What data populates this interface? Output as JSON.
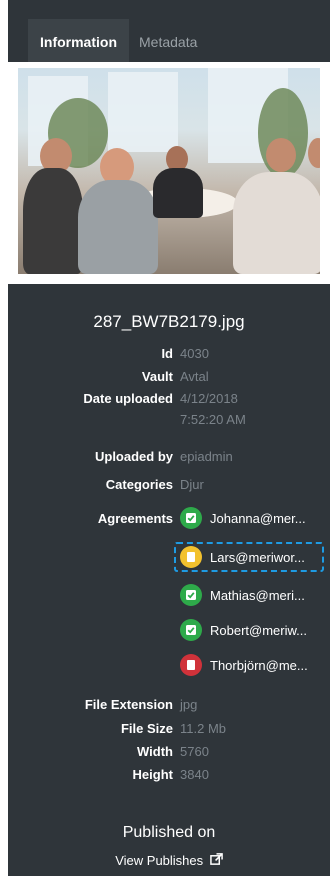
{
  "tabs": [
    {
      "label": "Information",
      "active": true
    },
    {
      "label": "Metadata",
      "active": false
    }
  ],
  "file": {
    "name": "287_BW7B2179.jpg",
    "fields": {
      "id": {
        "label": "Id",
        "value": "4030"
      },
      "vault": {
        "label": "Vault",
        "value": "Avtal"
      },
      "date_uploaded": {
        "label": "Date uploaded",
        "value": "4/12/2018 7:52:20 AM"
      },
      "uploaded_by": {
        "label": "Uploaded by",
        "value": "epiadmin"
      },
      "categories": {
        "label": "Categories",
        "value": "Djur"
      },
      "agreements_label": "Agreements",
      "file_extension": {
        "label": "File Extension",
        "value": "jpg"
      },
      "file_size": {
        "label": "File Size",
        "value": "11.2 Mb"
      },
      "width": {
        "label": "Width",
        "value": "5760"
      },
      "height": {
        "label": "Height",
        "value": "3840"
      }
    }
  },
  "agreements": [
    {
      "name": "Johanna@mer...",
      "status": "approved",
      "color": "#2eaa4a"
    },
    {
      "name": "Lars@meriwor...",
      "status": "pending",
      "color": "#f2c12e"
    },
    {
      "name": "Mathias@meri...",
      "status": "approved",
      "color": "#2eaa4a"
    },
    {
      "name": "Robert@meriw...",
      "status": "approved",
      "color": "#2eaa4a"
    },
    {
      "name": "Thorbjörn@me...",
      "status": "rejected",
      "color": "#d0323a"
    }
  ],
  "published": {
    "title": "Published on",
    "link_label": "View Publishes",
    "link_icon": "external-link-icon"
  },
  "colors": {
    "panel_bg": "#2f353a",
    "muted_text": "#7b838a",
    "selection": "#1e9be3"
  }
}
